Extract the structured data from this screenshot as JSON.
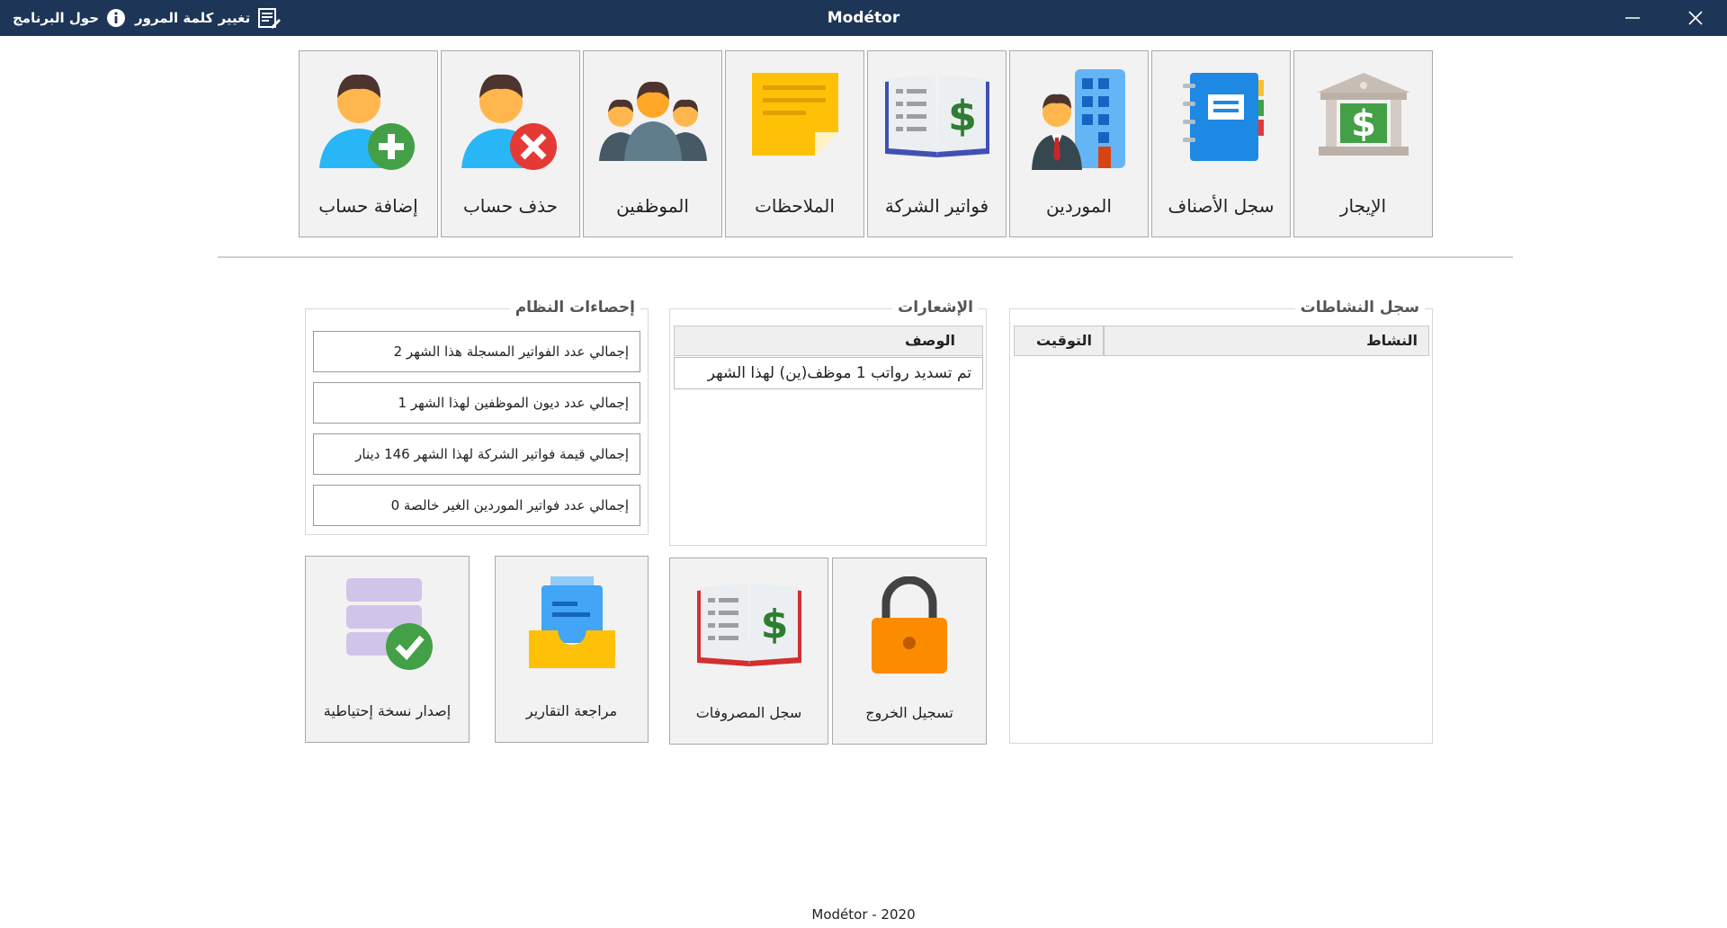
{
  "window": {
    "title": "Modétor",
    "about_label": "حول البرنامج",
    "change_password_label": "تغيير كلمة المرور"
  },
  "tiles_top": [
    {
      "label": "الإيجار",
      "icon": "bank-icon"
    },
    {
      "label": "سجل الأصناف",
      "icon": "notebook-icon"
    },
    {
      "label": "الموردين",
      "icon": "supplier-building-icon"
    },
    {
      "label": "فواتير الشركة",
      "icon": "invoice-book-icon"
    },
    {
      "label": "الملاحظات",
      "icon": "sticky-note-icon"
    },
    {
      "label": "الموظفين",
      "icon": "employees-group-icon"
    },
    {
      "label": "حذف حساب",
      "icon": "remove-user-icon"
    },
    {
      "label": "إضافة حساب",
      "icon": "add-user-icon"
    }
  ],
  "activity_log": {
    "title": "سجل النشاطات",
    "columns": [
      "النشاط",
      "التوقيت"
    ],
    "rows": []
  },
  "notifications": {
    "title": "الإشعارات",
    "column": "الوصف",
    "rows": [
      "تم تسديد رواتب 1 موظف(ين) لهذا الشهر"
    ]
  },
  "stats": {
    "title": "إحصاءات النظام",
    "items": [
      "إجمالي عدد الفواتير المسجلة هذا الشهر 2",
      "إجمالي عدد ديون الموظفين لهذا الشهر 1",
      "إجمالي قيمة فواتير الشركة لهذا الشهر 146 دينار",
      "إجمالي عدد فواتير الموردين الغير خالصة 0"
    ]
  },
  "tiles_bottom": [
    {
      "label": "تسجيل الخروج",
      "icon": "padlock-icon"
    },
    {
      "label": "سجل المصروفات",
      "icon": "expenses-book-icon"
    },
    {
      "label": "مراجعة التقارير",
      "icon": "reports-inbox-icon"
    },
    {
      "label": "إصدار نسخة إحتياطية",
      "icon": "backup-database-icon"
    }
  ],
  "footer": "Modétor - 2020",
  "colors": {
    "titlebar": "#1d3557",
    "tile_bg": "#f2f2f2",
    "tile_border": "#a9a9a9"
  }
}
